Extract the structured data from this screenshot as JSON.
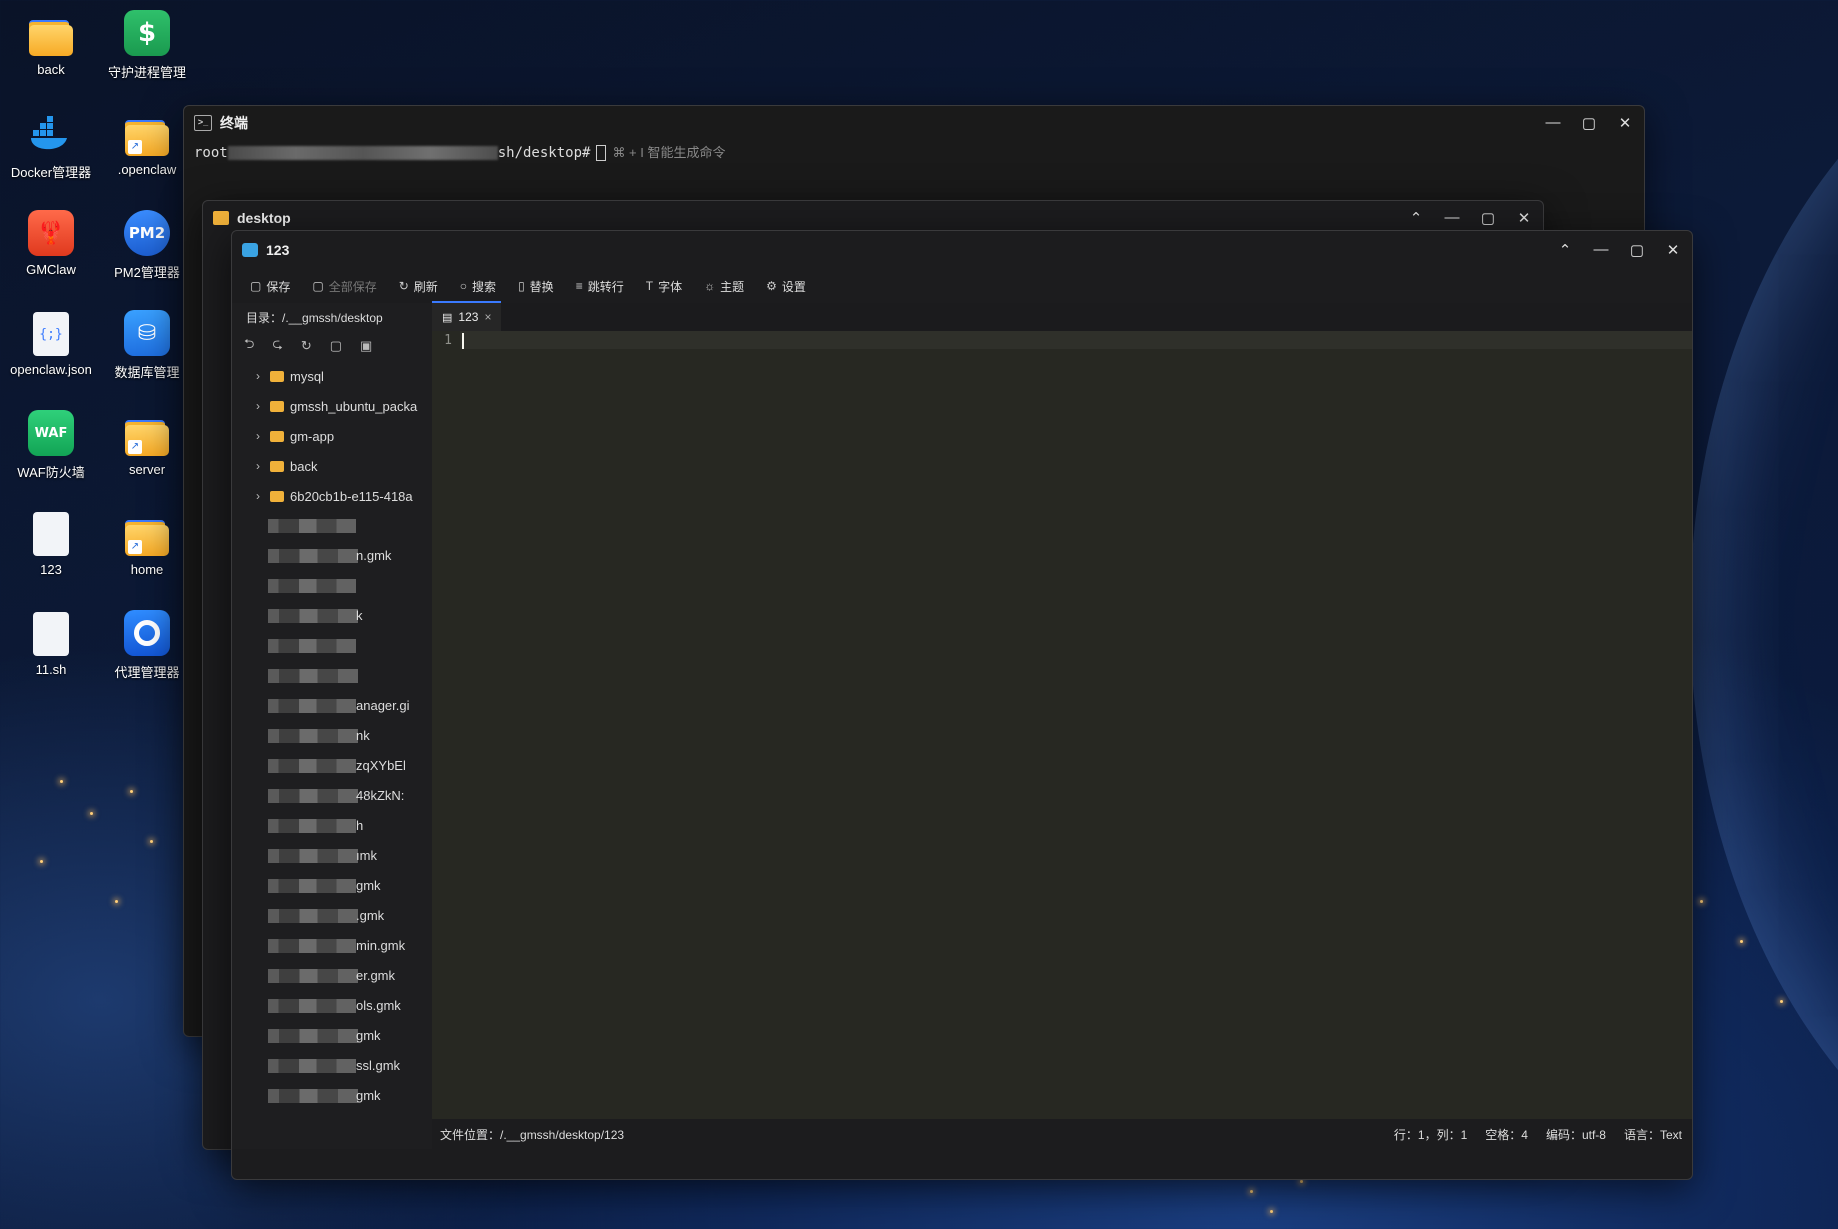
{
  "desktop": {
    "icons": [
      {
        "label": "back",
        "icon": "folder-icon"
      },
      {
        "label": "守护进程管理",
        "icon": "shield-s-icon"
      },
      {
        "label": "Docker管理器",
        "icon": "docker-icon"
      },
      {
        "label": ".openclaw",
        "icon": "folder-shortcut-icon"
      },
      {
        "label": "GMClaw",
        "icon": "gmclaw-icon"
      },
      {
        "label": "PM2管理器",
        "icon": "pm2-icon"
      },
      {
        "label": "openclaw.json",
        "icon": "json-file-icon",
        "glyph": "{;}"
      },
      {
        "label": "数据库管理",
        "icon": "database-icon"
      },
      {
        "label": "WAF防火墙",
        "icon": "waf-icon",
        "glyph": "WAF"
      },
      {
        "label": "server",
        "icon": "folder-shortcut-icon"
      },
      {
        "label": "123",
        "icon": "code-file-icon",
        "glyph": "</>"
      },
      {
        "label": "home",
        "icon": "folder-shortcut-icon"
      },
      {
        "label": "11.sh",
        "icon": "code-file-icon",
        "glyph": "</>"
      },
      {
        "label": "代理管理器",
        "icon": "proxy-icon"
      }
    ],
    "pm2_glyph": "PM2",
    "shortcut_glyph": "↗"
  },
  "terminal": {
    "title": "终端",
    "prompt_prefix": "root",
    "prompt_suffix": "sh/desktop#",
    "hint": "⌘ + I 智能生成命令"
  },
  "file_manager": {
    "title": "desktop"
  },
  "editor": {
    "title": "123",
    "toolbar": {
      "save": "保存",
      "save_all": "全部保存",
      "refresh": "刷新",
      "search": "搜索",
      "replace": "替换",
      "goto_line": "跳转行",
      "font": "字体",
      "theme": "主题",
      "settings": "设置"
    },
    "dir_label": "目录：/.__gmssh/desktop",
    "tab_name": "123",
    "tree_folders": [
      "mysql",
      "gmssh_ubuntu_packa",
      "gm-app",
      "back",
      "6b20cb1b-e115-418a"
    ],
    "tree_masked_tails": [
      "",
      "n.gmk",
      "",
      "k",
      "",
      "",
      "anager.gi",
      "nk",
      "zqXYbEl",
      "48kZkN:",
      "h",
      "ımk",
      "gmk",
      ".gmk",
      "min.gmk",
      "er.gmk",
      "ols.gmk",
      "gmk",
      "ssl.gmk",
      "gmk"
    ],
    "line_numbers": [
      "1"
    ],
    "status": {
      "path": "文件位置：/.__gmssh/desktop/123",
      "pos": "行：1，列：1",
      "spaces": "空格：4",
      "encoding": "编码：utf-8",
      "language": "语言：Text"
    }
  },
  "colors": {
    "accent": "#3a7afe",
    "editor_bg": "#272822",
    "folder": "#f0b13a"
  }
}
